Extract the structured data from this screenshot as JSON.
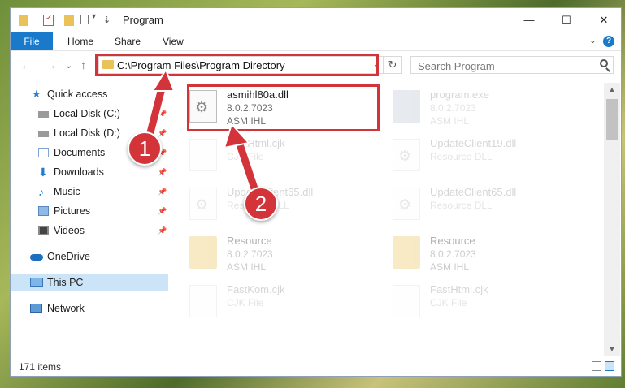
{
  "window": {
    "title": "Program",
    "quick_access_icons": [
      "folder-icon",
      "properties-icon",
      "new-folder-icon",
      "customize-dropdown-icon"
    ],
    "controls": {
      "minimize": "—",
      "maximize": "☐",
      "close": "✕"
    }
  },
  "ribbon": {
    "file": "File",
    "tabs": [
      "Home",
      "Share",
      "View"
    ],
    "help": "?",
    "expand": "⌄"
  },
  "nav": {
    "back": "←",
    "forward": "→",
    "recent": "⌄",
    "up": "↑",
    "address": "C:\\Program Files\\Program Directory",
    "address_dropdown": "⌄",
    "refresh": "↻",
    "search_placeholder": "Search Program"
  },
  "sidebar": {
    "items": [
      {
        "label": "Quick access",
        "icon": "star-icon",
        "pinned": false
      },
      {
        "label": "Local Disk (C:)",
        "icon": "drive-icon",
        "pinned": true
      },
      {
        "label": "Local Disk (D:)",
        "icon": "drive-icon",
        "pinned": true
      },
      {
        "label": "Documents",
        "icon": "documents-icon",
        "pinned": true
      },
      {
        "label": "Downloads",
        "icon": "download-icon",
        "pinned": true
      },
      {
        "label": "Music",
        "icon": "music-icon",
        "pinned": true
      },
      {
        "label": "Pictures",
        "icon": "pictures-icon",
        "pinned": true
      },
      {
        "label": "Videos",
        "icon": "videos-icon",
        "pinned": true
      },
      {
        "label": "OneDrive",
        "icon": "cloud-icon",
        "pinned": false
      },
      {
        "label": "This PC",
        "icon": "computer-icon",
        "pinned": false,
        "selected": true
      },
      {
        "label": "Network",
        "icon": "network-icon",
        "pinned": false
      }
    ],
    "pin_glyph": "📌"
  },
  "files": [
    {
      "name": "asmihl80a.dll",
      "version": "8.0.2.7023",
      "company": "ASM IHL",
      "icon": "dll-gear-icon",
      "highlighted": true
    },
    {
      "name": "program.exe",
      "version": "8.0.2.7023",
      "company": "ASM IHL",
      "icon": "exe-icon"
    },
    {
      "name": "FastHtml.cjk",
      "version": "",
      "company": "CJK File",
      "icon": "file-icon"
    },
    {
      "name": "UpdateClient19.dll",
      "version": "",
      "company": "Resource DLL",
      "icon": "dll-gear-icon"
    },
    {
      "name": "UpdateClient65.dll",
      "version": "",
      "company": "Resource DLL",
      "icon": "dll-gear-icon"
    },
    {
      "name": "UpdateClient65.dll",
      "version": "",
      "company": "Resource DLL",
      "icon": "dll-gear-icon"
    },
    {
      "name": "Resource",
      "version": "8.0.2.7023",
      "company": "ASM IHL",
      "icon": "folder-icon"
    },
    {
      "name": "Resource",
      "version": "8.0.2.7023",
      "company": "ASM IHL",
      "icon": "folder-icon"
    },
    {
      "name": "FastKom.cjk",
      "version": "",
      "company": "CJK File",
      "icon": "file-icon"
    },
    {
      "name": "FastHtml.cjk",
      "version": "",
      "company": "CJK File",
      "icon": "file-icon"
    }
  ],
  "status": {
    "items_count": "171 items"
  },
  "annotations": {
    "badge1": "1",
    "badge2": "2",
    "color": "#d3343a"
  }
}
